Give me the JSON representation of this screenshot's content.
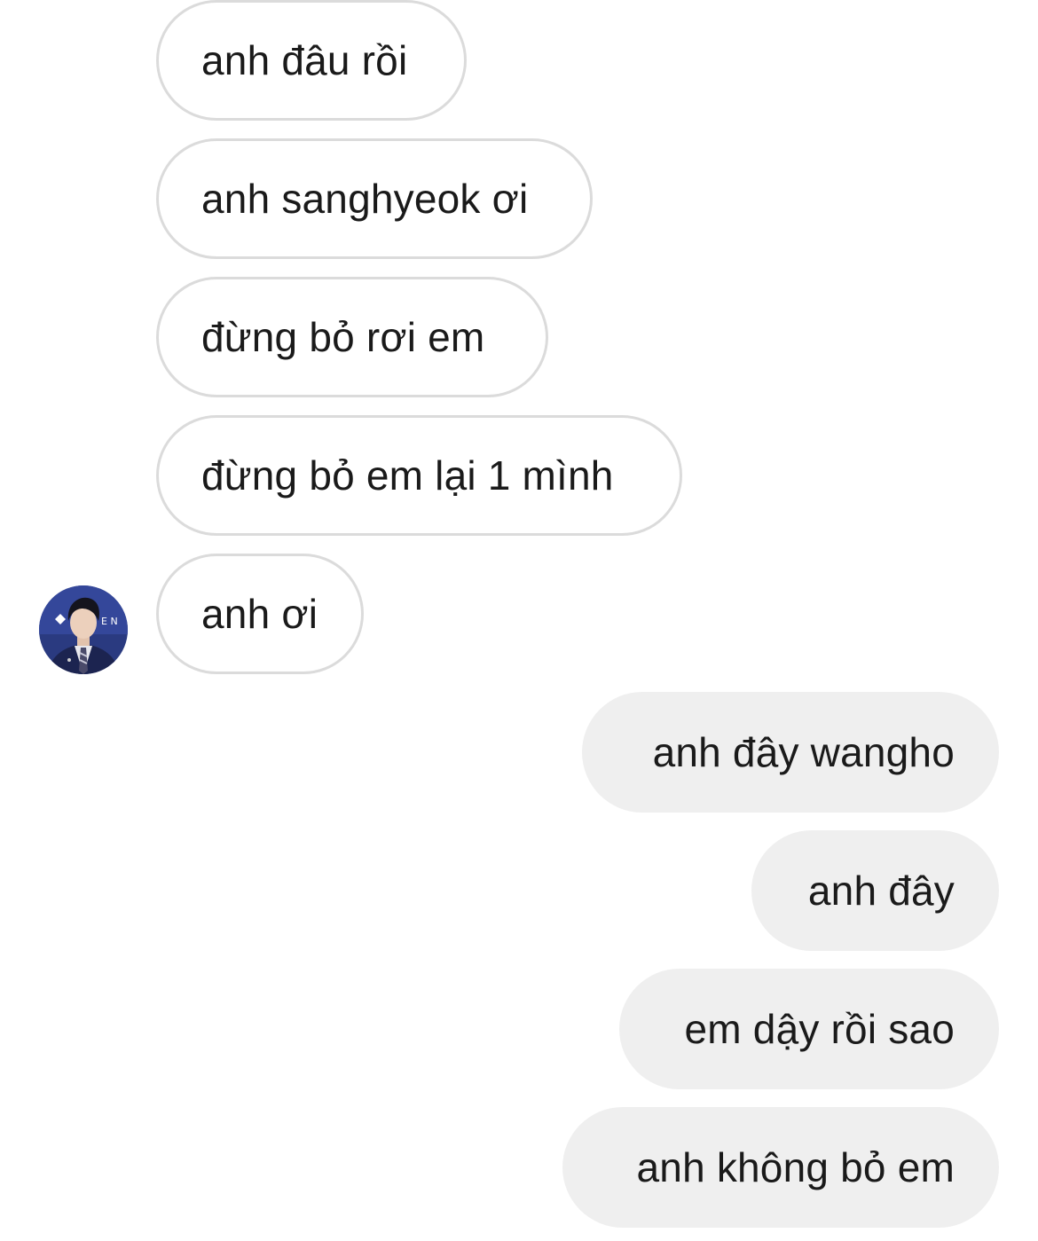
{
  "conversation": {
    "incoming_messages": [
      {
        "text": "anh đâu rồi"
      },
      {
        "text": "anh sanghyeok ơi"
      },
      {
        "text": "đừng bỏ rơi em"
      },
      {
        "text": "đừng bỏ em lại 1 mình"
      },
      {
        "text": "anh ơi"
      }
    ],
    "outgoing_messages": [
      {
        "text": "anh đây wangho"
      },
      {
        "text": "anh đây"
      },
      {
        "text": "em dậy rồi sao"
      },
      {
        "text": "anh không bỏ em"
      }
    ],
    "avatar": {
      "icon": "profile-photo",
      "badge_text": "E N"
    }
  },
  "colors": {
    "incoming_bubble": "#ffffff",
    "incoming_border": "#dbdbdb",
    "outgoing_bubble": "#efefef",
    "text": "#1a1a1a",
    "avatar_bg": "#2a3a80"
  }
}
